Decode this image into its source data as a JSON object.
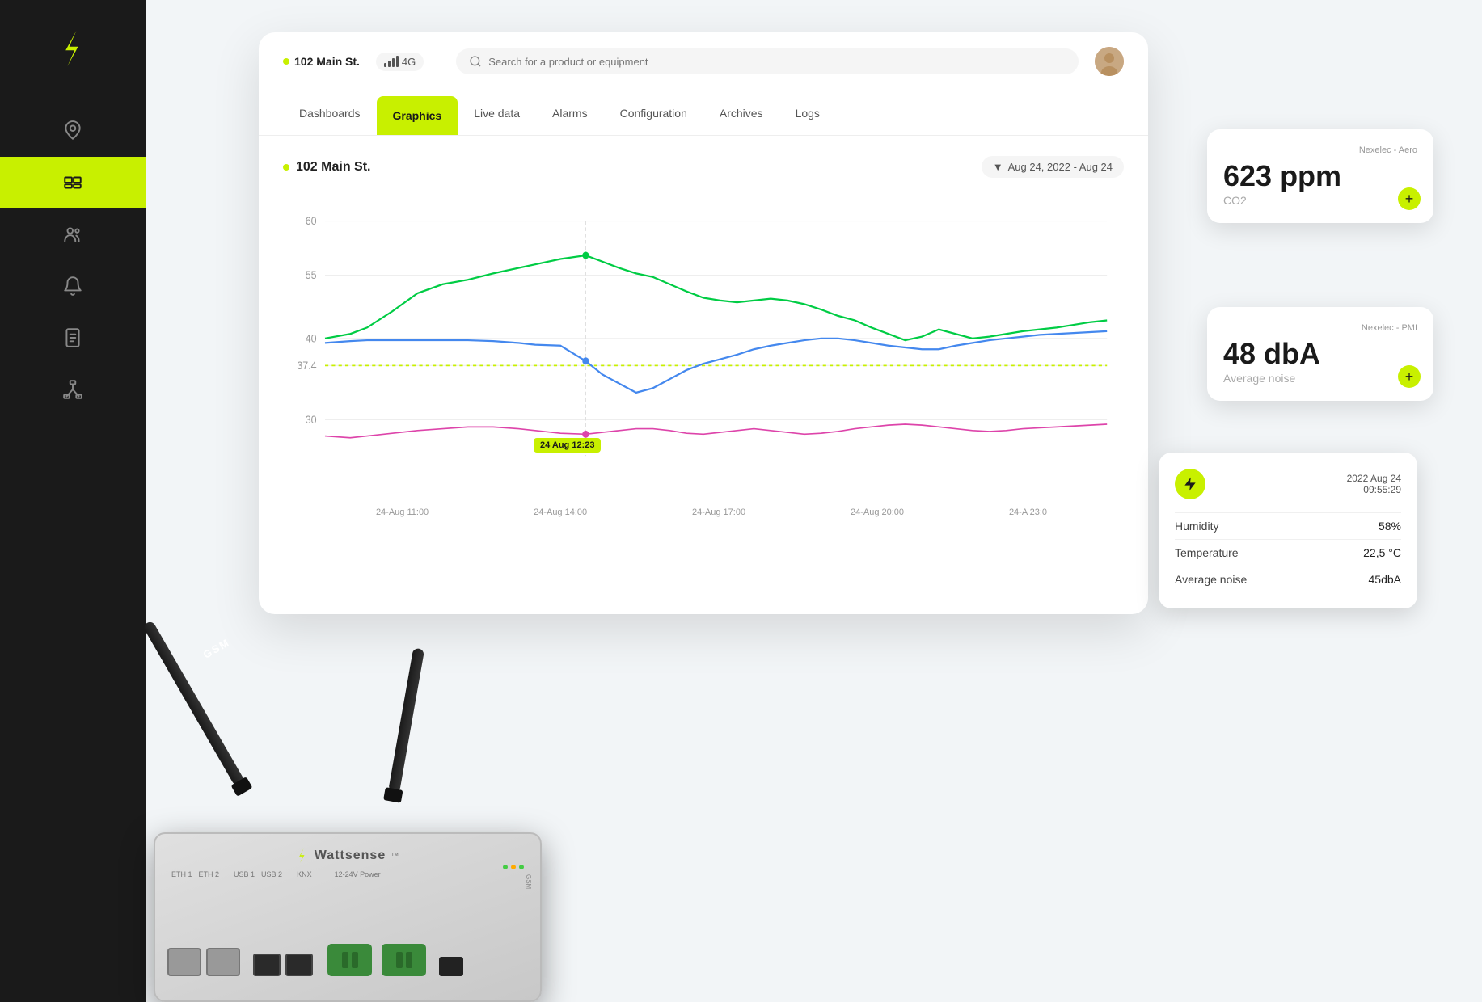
{
  "sidebar": {
    "logo_alt": "Wattsense logo",
    "items": [
      {
        "id": "location",
        "icon": "location-icon",
        "active": false
      },
      {
        "id": "devices",
        "icon": "devices-icon",
        "active": true
      },
      {
        "id": "settings",
        "icon": "settings-icon",
        "active": false
      },
      {
        "id": "alerts",
        "icon": "alerts-icon",
        "active": false
      },
      {
        "id": "reports",
        "icon": "reports-icon",
        "active": false
      },
      {
        "id": "network",
        "icon": "network-icon",
        "active": false
      }
    ]
  },
  "header": {
    "location": "102 Main St.",
    "signal": "4G",
    "search_placeholder": "Search for a product or equipment"
  },
  "nav": {
    "tabs": [
      {
        "id": "dashboards",
        "label": "Dashboards",
        "active": false
      },
      {
        "id": "graphics",
        "label": "Graphics",
        "active": true
      },
      {
        "id": "live_data",
        "label": "Live data",
        "active": false
      },
      {
        "id": "alarms",
        "label": "Alarms",
        "active": false
      },
      {
        "id": "configuration",
        "label": "Configuration",
        "active": false
      },
      {
        "id": "archives",
        "label": "Archives",
        "active": false
      },
      {
        "id": "logs",
        "label": "Logs",
        "active": false
      }
    ]
  },
  "chart": {
    "title": "102 Main St.",
    "date_range": "Aug 24, 2022 - Aug 24",
    "y_axis": [
      "60",
      "55",
      "40",
      "37.4",
      "30"
    ],
    "x_axis": [
      "24-Aug 11:00",
      "24-Aug 14:00",
      "24-Aug 17:00",
      "24-Aug 20:00",
      "24-A 23:0"
    ],
    "tooltip": "24 Aug 12:23"
  },
  "cards": {
    "card1": {
      "source": "Nexelec - Aero",
      "value": "623 ppm",
      "label": "CO2",
      "plus": "+"
    },
    "card2": {
      "source": "Nexelec - PMI",
      "value": "48 dbA",
      "label": "Average noise",
      "plus": "+"
    }
  },
  "popup": {
    "date": "2022 Aug 24",
    "time": "09:55:29",
    "rows": [
      {
        "label": "Humidity",
        "value": "58%"
      },
      {
        "label": "Temperature",
        "value": "22,5 °C"
      },
      {
        "label": "Average noise",
        "value": "45dbA"
      }
    ]
  },
  "device": {
    "brand": "Wattsense",
    "model": "GSM",
    "label_text": "Wattsense"
  }
}
